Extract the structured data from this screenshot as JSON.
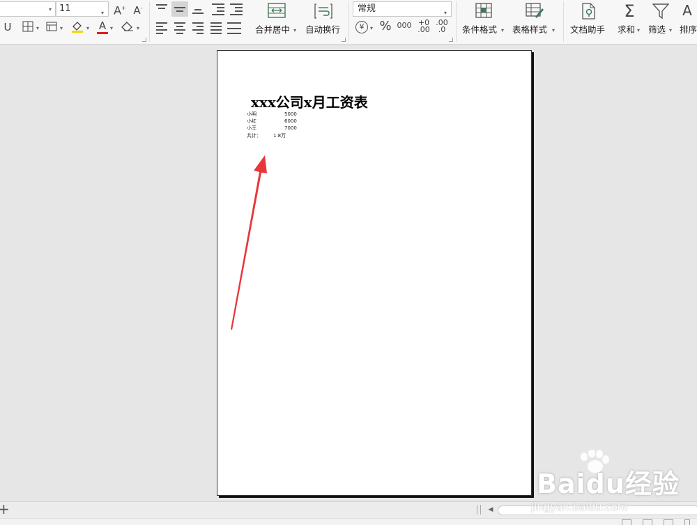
{
  "ribbon": {
    "font_size": "11",
    "number_format": "常规",
    "buttons": {
      "merge_center": "合并居中",
      "wrap_text": "自动换行",
      "conditional_format": "条件格式",
      "table_style": "表格样式",
      "doc_assistant": "文档助手",
      "sum": "求和",
      "filter": "筛选",
      "sort": "排序"
    },
    "icons": {
      "increase_font": "A⁺",
      "decrease_font": "A⁻",
      "underline": "U",
      "font_color_letter": "A",
      "percent": "%",
      "thousands": "000",
      "dec_increase": ".0→.00",
      "dec_decrease": ".00→.0",
      "currency": "¥",
      "sum_symbol": "Σ",
      "sort_letter": "A"
    },
    "colors": {
      "font_color": "#e02020",
      "fill_color": "#f2d600"
    }
  },
  "page": {
    "title": "xxx公司x月工资表",
    "rows": [
      {
        "name": "小明",
        "value": "5000"
      },
      {
        "name": "小红",
        "value": "6000"
      },
      {
        "name": "小王",
        "value": "7000"
      }
    ],
    "total_label": "共计：",
    "total_value": "1.8万"
  },
  "annotation": {
    "arrow_color": "#e8373b"
  },
  "bottom": {
    "add_sheet": "+"
  },
  "watermark": {
    "main": "Baidu经验",
    "sub": "jingyan.baidu.com"
  }
}
